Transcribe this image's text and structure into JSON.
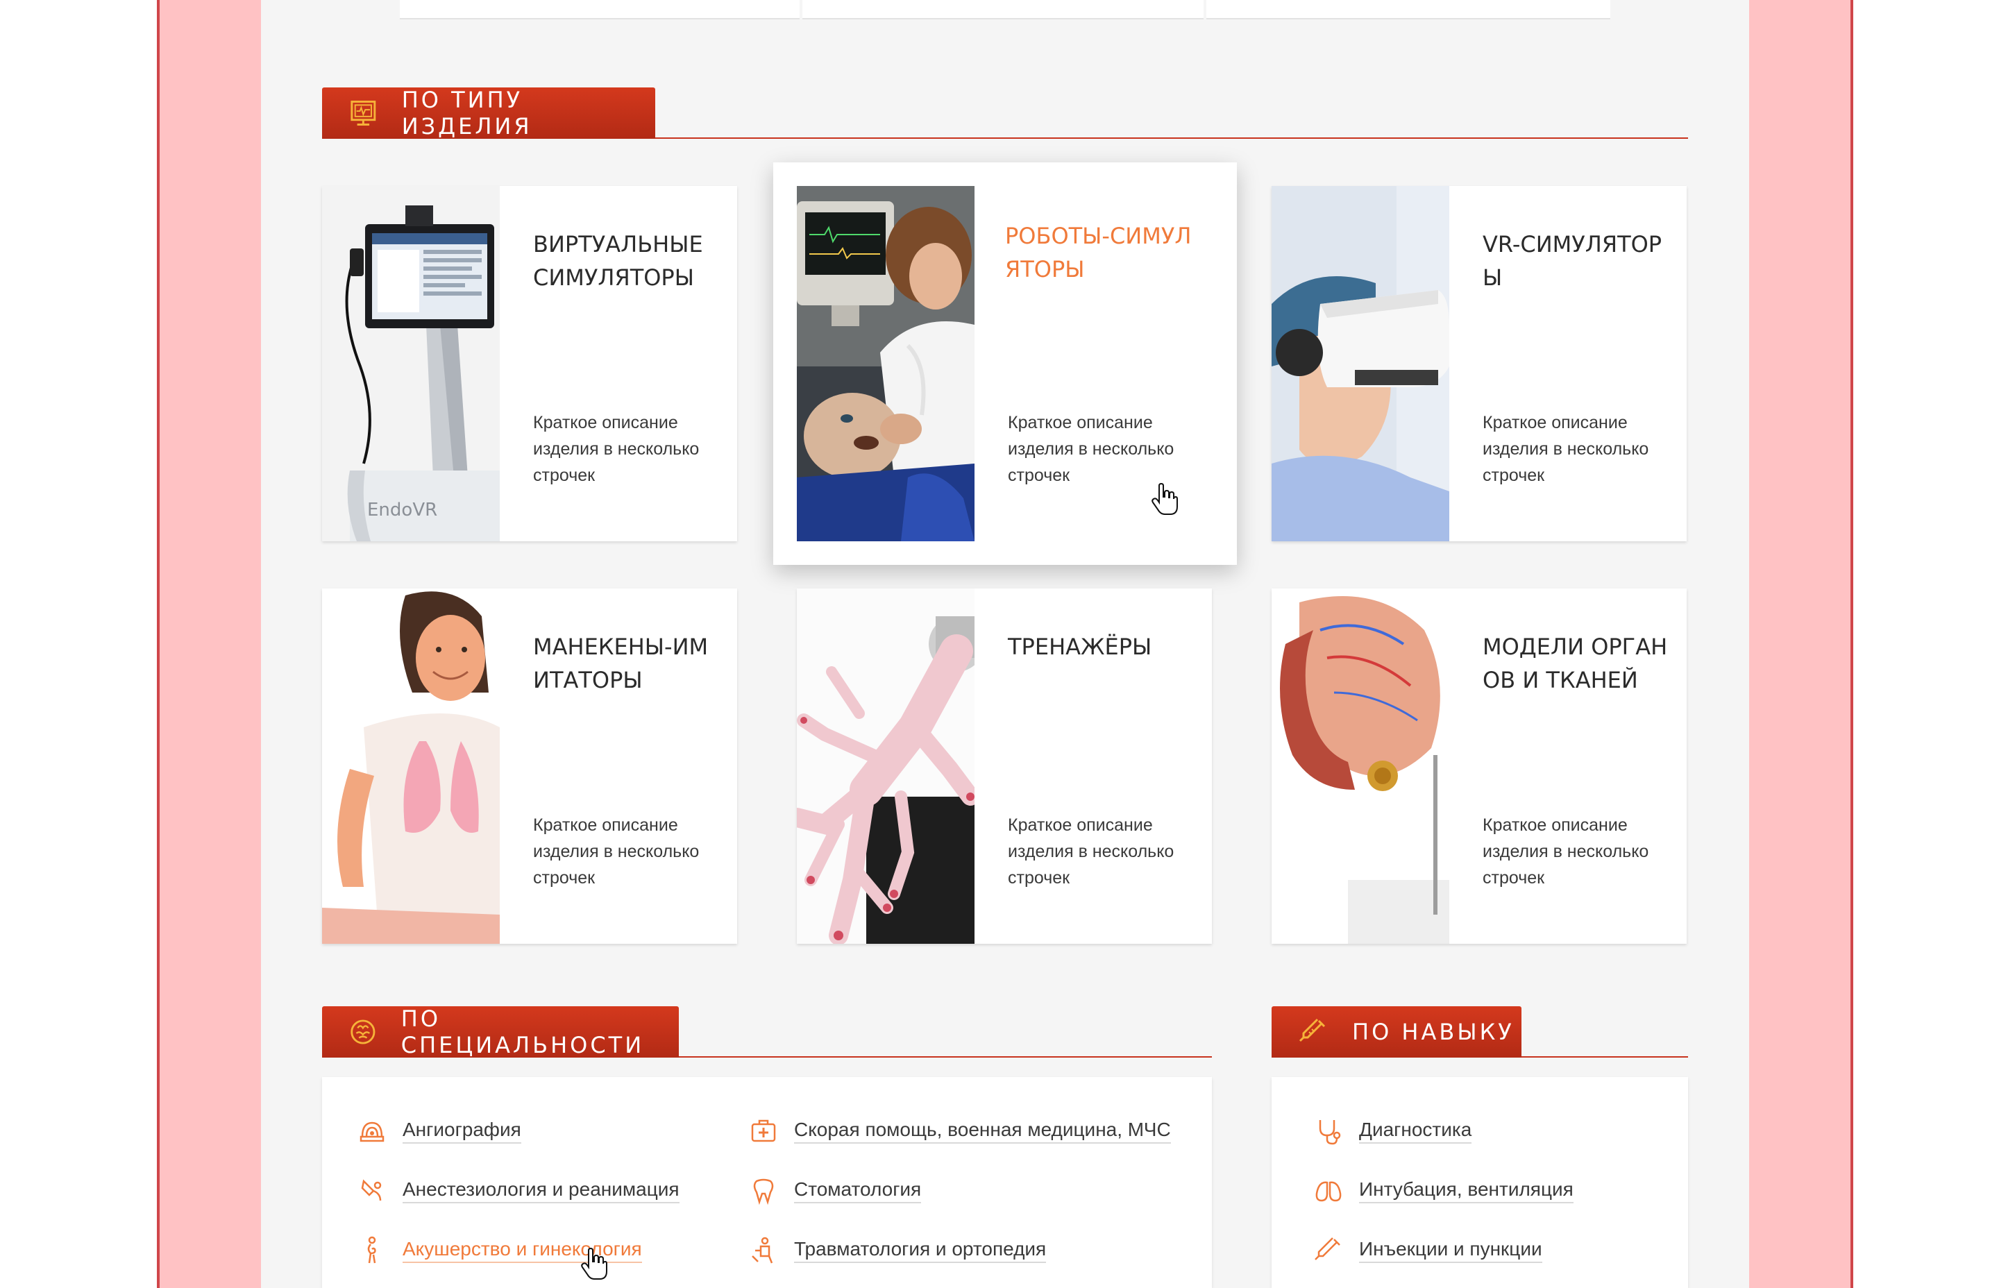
{
  "colors": {
    "accent": "#f07a3a",
    "brand_red": "#c8331d",
    "frame_pink": "#ffc2c4"
  },
  "product_type_section": {
    "title": "ПО ТИПУ ИЗДЕЛИЯ",
    "icon": "monitor-icon",
    "cards": [
      {
        "title": "ВИРТУАЛЬНЫЕ СИМУЛЯТОРЫ",
        "description": "Краткое описание изделия в несколько строчек",
        "image": "endovr-simulator-image",
        "image_caption": "EndoVR",
        "highlighted": false
      },
      {
        "title": "РОБОТЫ-СИМУЛЯТОРЫ",
        "description": "Краткое описание изделия в несколько строчек",
        "image": "robot-mannequin-image",
        "highlighted": true
      },
      {
        "title": "VR-СИМУЛЯТОРЫ",
        "description": "Краткое описание изделия в несколько строчек",
        "image": "vr-headset-image",
        "highlighted": false
      },
      {
        "title": "МАНЕКЕНЫ-ИМИТАТОРЫ",
        "description": "Краткое описание изделия в несколько строчек",
        "image": "child-mannequin-image",
        "highlighted": false
      },
      {
        "title": "ТРЕНАЖЁРЫ",
        "description": "Краткое описание изделия в несколько строчек",
        "image": "bronchial-tree-image",
        "highlighted": false
      },
      {
        "title": "МОДЕЛИ ОРГАНОВ И ТКАНЕЙ",
        "description": "Краткое описание изделия в несколько строчек",
        "image": "organ-model-image",
        "highlighted": false
      }
    ]
  },
  "specialty_section": {
    "title": "ПО СПЕЦИАЛЬНОСТИ",
    "icon": "brain-icon",
    "items": [
      {
        "label": "Ангиография",
        "icon": "angiography-icon"
      },
      {
        "label": "Анестезиология и реанимация",
        "icon": "anesthesia-icon"
      },
      {
        "label": "Акушерство и гинекология",
        "icon": "pregnancy-icon",
        "active": true
      },
      {
        "label": "Скорая помощь, военная медицина, МЧС",
        "icon": "first-aid-icon"
      },
      {
        "label": "Стоматология",
        "icon": "tooth-icon"
      },
      {
        "label": "Травматология и ортопедия",
        "icon": "orthopedics-icon"
      }
    ]
  },
  "skill_section": {
    "title": "ПО НАВЫКУ",
    "icon": "syringe-icon",
    "items": [
      {
        "label": "Диагностика",
        "icon": "stethoscope-icon"
      },
      {
        "label": "Интубация, вентиляция",
        "icon": "lungs-icon"
      },
      {
        "label": "Инъекции и пункции",
        "icon": "syringe-small-icon"
      }
    ]
  }
}
